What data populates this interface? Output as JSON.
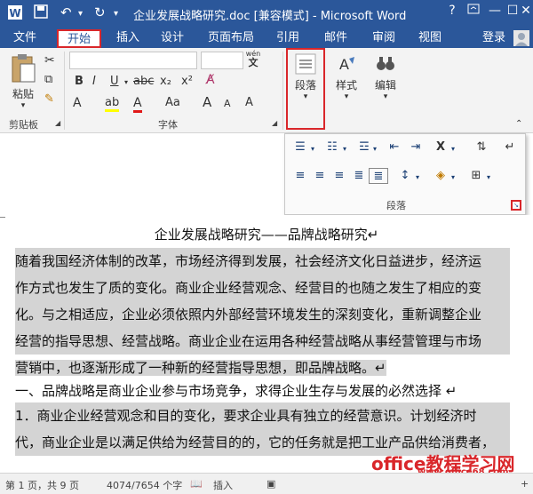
{
  "titlebar": {
    "title": "企业发展战略研究.doc [兼容模式] - Microsoft Word",
    "help": "?",
    "minimize": "—",
    "maximize": "☐",
    "close": "✕"
  },
  "tabs": {
    "file": "文件",
    "home": "开始",
    "insert": "插入",
    "design": "设计",
    "layout": "页面布局",
    "references": "引用",
    "mailings": "邮件",
    "review": "审阅",
    "view": "视图",
    "login": "登录"
  },
  "ribbon": {
    "paste": "粘贴",
    "clipboard": "剪贴板",
    "font_group": "字体",
    "paragraph": "段落",
    "style": "样式",
    "edit": "编辑",
    "font_size_small": "A",
    "wen": "wén"
  },
  "panel": {
    "label": "段落"
  },
  "document": {
    "title": "企业发展战略研究——品牌战略研究↵",
    "lines": [
      "随着我国经济体制的改革，市场经济得到发展，社会经济文化日益进步，经济运",
      "作方式也发生了质的变化。商业企业经营观念、经营目的也随之发生了相应的变",
      "化。与之相适应，企业必须依照内外部经营环境发生的深刻变化，重新调整企业",
      "经营的指导思想、经营战略。商业企业在运用各种经营战略从事经营管理与市场",
      "营销中，也逐渐形成了一种新的经营指导思想，即品牌战略。↵",
      "一、品牌战略是商业企业参与市场竞争，求得企业生存与发展的必然选择 ↵",
      "1．商业企业经营观念和目的变化，要求企业具有独立的经营意识。计划经济时",
      "代，商业企业是以满足供给为经营目的的，它的任务就是把工业产品供给消费者，"
    ]
  },
  "statusbar": {
    "page": "第 1 页，共 9 页",
    "words": "4074/7654 个字",
    "mode": "插入",
    "zoom": "+"
  },
  "watermark": {
    "site": "office教程学习网",
    "url": "www.office68.com"
  }
}
